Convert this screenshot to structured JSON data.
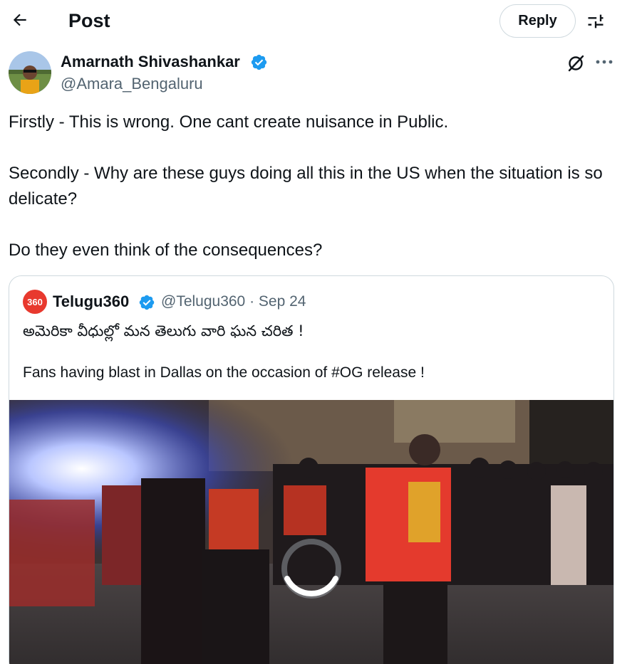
{
  "header": {
    "title": "Post",
    "reply_label": "Reply"
  },
  "post": {
    "author_name": "Amarnath Shivashankar",
    "handle": "@Amara_Bengaluru",
    "paragraphs": [
      "Firstly - This is wrong. One cant create nuisance in Public.",
      "Secondly - Why are these guys doing all this in the US when the situation is so delicate?",
      "Do they even think of the consequences?"
    ]
  },
  "quote": {
    "avatar_text": "360",
    "name": "Telugu360",
    "meta": "@Telugu360 · Sep 24",
    "text_line1": "అమెరికా వీధుల్లో మన తెలుగు వారి ఘన చరిత !",
    "text_line2": "Fans having blast in Dallas on the occasion of #OG release  !"
  },
  "icons": {
    "back": "arrow-left-icon",
    "filter": "sliders-icon",
    "verified": "verified-badge-icon",
    "grok": "grok-icon",
    "more": "more-dots-icon",
    "loading": "loading-spinner-icon"
  },
  "colors": {
    "accent": "#1d9bf0",
    "text": "#0f1419",
    "secondary": "#536471",
    "border": "#cfd9de",
    "quote_avatar": "#e8392e"
  }
}
